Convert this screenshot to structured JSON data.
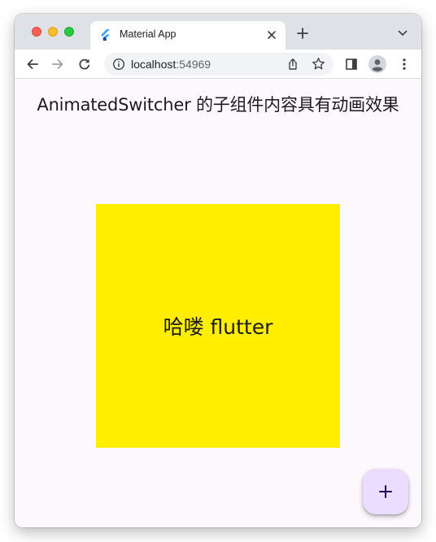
{
  "browser": {
    "tab_title": "Material App",
    "url_host": "localhost",
    "url_port": ":54969",
    "icons": [
      "back-icon",
      "forward-icon",
      "reload-icon",
      "info-icon",
      "share-icon",
      "star-icon",
      "sidepanel-icon",
      "profile-icon",
      "menu-icon",
      "plus-icon",
      "close-icon",
      "chevron-down-icon"
    ]
  },
  "app": {
    "title": "AnimatedSwitcher 的子组件内容具有动画效果",
    "box_text": "哈喽 flutter",
    "box_color": "#ffee00",
    "fab_icon": "add-icon",
    "fab_color": "#eaddff"
  }
}
